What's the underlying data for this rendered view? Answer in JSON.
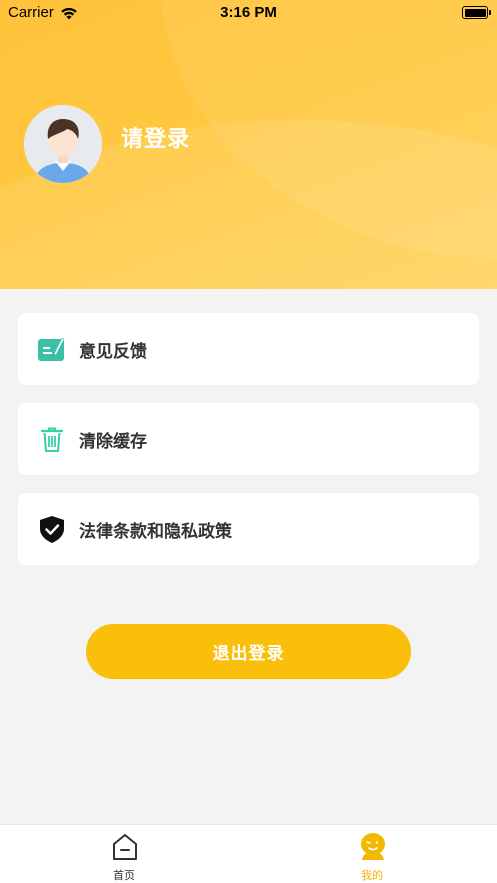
{
  "status_bar": {
    "carrier": "Carrier",
    "time": "3:16 PM"
  },
  "profile": {
    "login_prompt": "请登录"
  },
  "menu": {
    "items": [
      {
        "label": "意见反馈",
        "icon": "feedback-icon",
        "color": "#3dbfa5"
      },
      {
        "label": "清除缓存",
        "icon": "trash-icon",
        "color": "#36d1a6"
      },
      {
        "label": "法律条款和隐私政策",
        "icon": "shield-check-icon",
        "color": "#111111"
      }
    ]
  },
  "logout": {
    "label": "退出登录",
    "color": "#f9bf0a"
  },
  "tabbar": {
    "tabs": [
      {
        "label": "首页",
        "icon": "home-icon",
        "active": false
      },
      {
        "label": "我的",
        "icon": "profile-face-icon",
        "active": true
      }
    ]
  },
  "colors": {
    "header": "#ffc23a",
    "accent": "#f9bf0a",
    "background": "#f3f3f3"
  }
}
